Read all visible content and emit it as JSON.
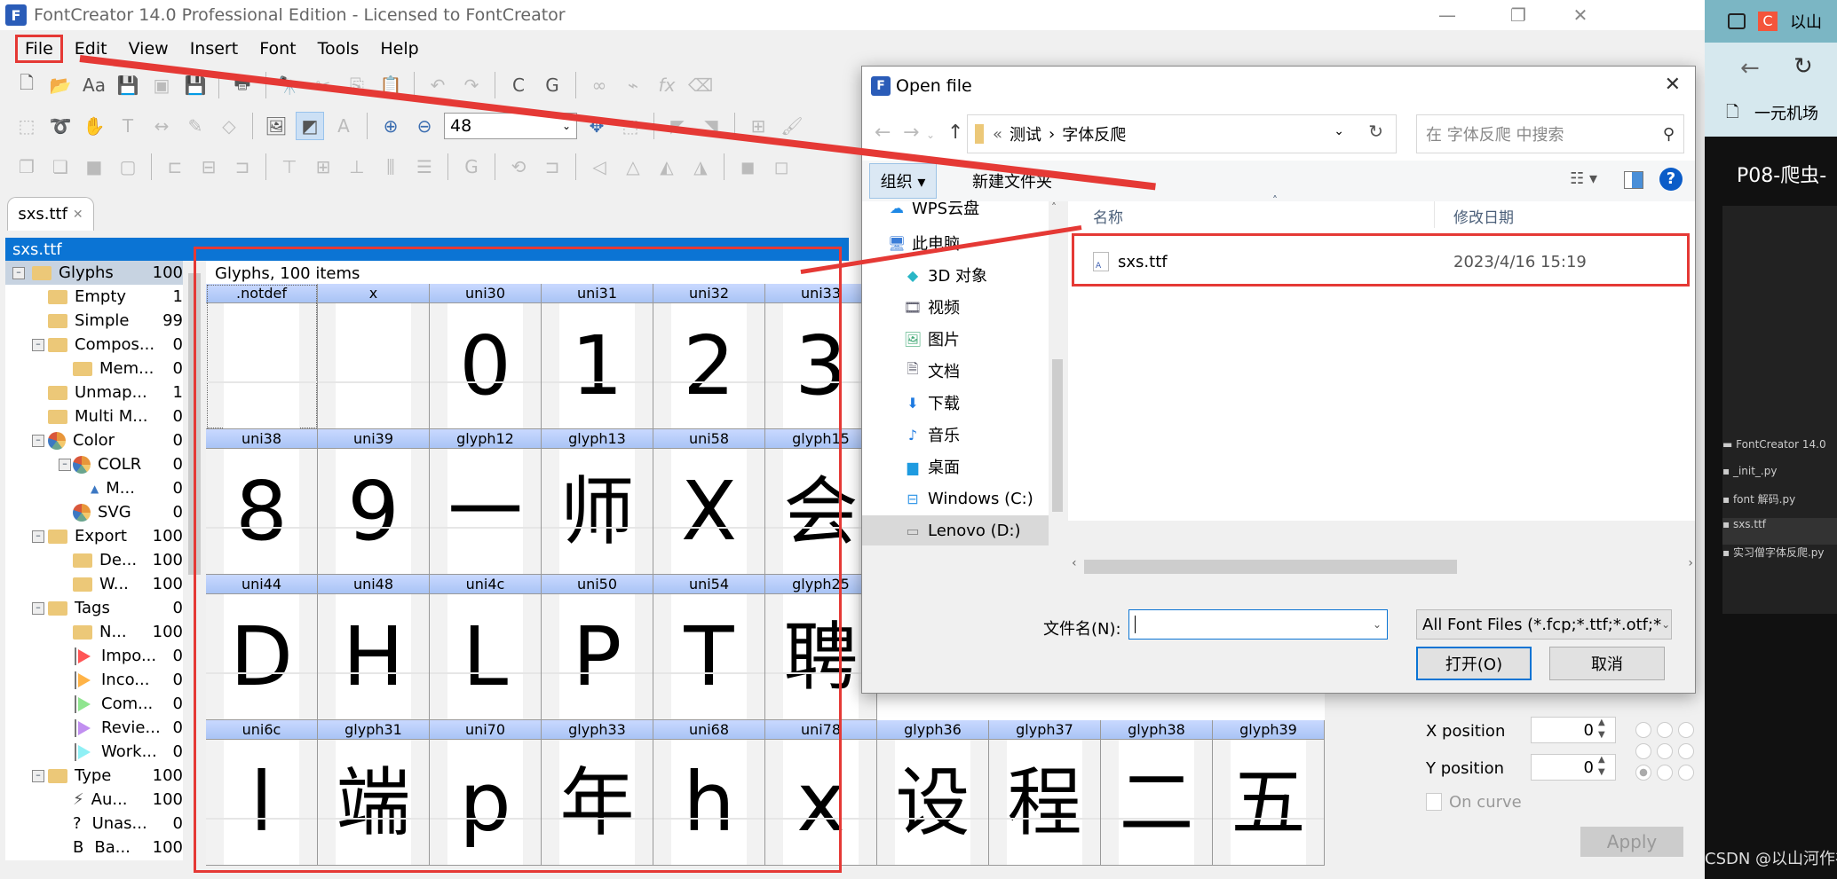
{
  "app": {
    "title": "FontCreator 14.0 Professional Edition - Licensed to FontCreator",
    "menu": [
      "File",
      "Edit",
      "View",
      "Insert",
      "Font",
      "Tools",
      "Help"
    ],
    "zoom_value": "48",
    "doc_tab": "sxs.ttf",
    "panel_title": "sxs.ttf"
  },
  "tree": [
    {
      "label": "Glyphs",
      "count": "100",
      "icon": "folder-icon",
      "level": 0,
      "root": true
    },
    {
      "label": "Empty",
      "count": "1",
      "icon": "folder-icon",
      "level": 1
    },
    {
      "label": "Simple",
      "count": "99",
      "icon": "folder-icon",
      "level": 1
    },
    {
      "label": "Compos...",
      "count": "0",
      "icon": "folder-icon",
      "level": 1
    },
    {
      "label": "Mem...",
      "count": "0",
      "icon": "folder-icon",
      "level": 2
    },
    {
      "label": "Unmap...",
      "count": "1",
      "icon": "folder-icon",
      "level": 1
    },
    {
      "label": "Multi M...",
      "count": "0",
      "icon": "folder-icon",
      "level": 1
    },
    {
      "label": "Color",
      "count": "0",
      "icon": "color-pie-icon",
      "level": 1
    },
    {
      "label": "COLR",
      "count": "0",
      "icon": "color-pie-icon",
      "level": 2
    },
    {
      "label": "M...",
      "count": "0",
      "icon": "triangle-icon",
      "level": 3
    },
    {
      "label": "SVG",
      "count": "0",
      "icon": "color-pie-icon",
      "level": 2
    },
    {
      "label": "Export",
      "count": "100",
      "icon": "folder-icon",
      "level": 1
    },
    {
      "label": "De...",
      "count": "100",
      "icon": "folder-icon",
      "level": 2
    },
    {
      "label": "W...",
      "count": "100",
      "icon": "folder-icon",
      "level": 2
    },
    {
      "label": "Tags",
      "count": "0",
      "icon": "folder-icon",
      "level": 1
    },
    {
      "label": "N...",
      "count": "100",
      "icon": "folder-icon",
      "level": 2
    },
    {
      "label": "Impo...",
      "count": "0",
      "icon": "flag-red-icon",
      "level": 2
    },
    {
      "label": "Inco...",
      "count": "0",
      "icon": "flag-orange-icon",
      "level": 2
    },
    {
      "label": "Com...",
      "count": "0",
      "icon": "flag-green-icon",
      "level": 2
    },
    {
      "label": "Revie...",
      "count": "0",
      "icon": "flag-purple-icon",
      "level": 2
    },
    {
      "label": "Work...",
      "count": "0",
      "icon": "flag-cyan-icon",
      "level": 2
    },
    {
      "label": "Type",
      "count": "100",
      "icon": "folder-icon",
      "level": 1
    },
    {
      "label": "Au...",
      "count": "100",
      "icon": "lightning-icon",
      "level": 2
    },
    {
      "label": "Unas...",
      "count": "0",
      "icon": "question-icon",
      "level": 2
    },
    {
      "label": "Ba...",
      "count": "100",
      "icon": "b-letter-icon",
      "level": 2
    }
  ],
  "glyphs": {
    "title": "Glyphs, 100 items",
    "rows": [
      [
        {
          "name": ".notdef",
          "ch": ""
        },
        {
          "name": "x",
          "ch": ""
        },
        {
          "name": "uni30",
          "ch": "0"
        },
        {
          "name": "uni31",
          "ch": "1"
        },
        {
          "name": "uni32",
          "ch": "2"
        },
        {
          "name": "uni33",
          "ch": "3"
        }
      ],
      [
        {
          "name": "uni38",
          "ch": "8"
        },
        {
          "name": "uni39",
          "ch": "9"
        },
        {
          "name": "glyph12",
          "ch": "一"
        },
        {
          "name": "glyph13",
          "ch": "师"
        },
        {
          "name": "uni58",
          "ch": "X"
        },
        {
          "name": "glyph15",
          "ch": "会"
        }
      ],
      [
        {
          "name": "uni44",
          "ch": "D"
        },
        {
          "name": "uni48",
          "ch": "H"
        },
        {
          "name": "uni4c",
          "ch": "L"
        },
        {
          "name": "uni50",
          "ch": "P"
        },
        {
          "name": "uni54",
          "ch": "T"
        },
        {
          "name": "glyph25",
          "ch": "聘"
        }
      ],
      [
        {
          "name": "uni6c",
          "ch": "l"
        },
        {
          "name": "glyph31",
          "ch": "端"
        },
        {
          "name": "uni70",
          "ch": "p"
        },
        {
          "name": "glyph33",
          "ch": "年"
        },
        {
          "name": "uni68",
          "ch": "h"
        },
        {
          "name": "uni78",
          "ch": "x"
        },
        {
          "name": "glyph36",
          "ch": "设"
        },
        {
          "name": "glyph37",
          "ch": "程"
        },
        {
          "name": "glyph38",
          "ch": "二"
        },
        {
          "name": "glyph39",
          "ch": "五"
        }
      ]
    ]
  },
  "dialog": {
    "title": "Open file",
    "breadcrumb": [
      "«",
      "测试",
      "›",
      "字体反爬"
    ],
    "search_placeholder": "在 字体反爬 中搜索",
    "organize": "组织 ▾",
    "new_folder": "新建文件夹",
    "nav": [
      "WPS云盘",
      "此电脑",
      "3D 对象",
      "视频",
      "图片",
      "文档",
      "下载",
      "音乐",
      "桌面",
      "Windows (C:)",
      "Lenovo (D:)"
    ],
    "col_name": "名称",
    "col_date": "修改日期",
    "file_name": "sxs.ttf",
    "file_date": "2023/4/16 15:19",
    "filename_label": "文件名(N):",
    "filename_value": "",
    "filetype": "All Font Files (*.fcp;*.ttf;*.otf;*",
    "open_btn": "打开(O)",
    "cancel_btn": "取消"
  },
  "props": {
    "x_label": "X position",
    "x_value": "0",
    "y_label": "Y position",
    "y_value": "0",
    "on_curve": "On curve",
    "apply": "Apply"
  },
  "side": {
    "tab_label": "以山",
    "bookmark": "一元机场",
    "video_title": "P08-爬虫-",
    "watermark": "CSDN @以山河作礼。",
    "files": [
      "FontCreator 14.0",
      "_init_.py",
      "font 解码.py",
      "sxs.ttf",
      "实习僧字体反爬.py"
    ]
  },
  "colors": {
    "accent": "#0b74d4",
    "annotation": "#e53935",
    "glyph_header": "#b3cbf7"
  }
}
